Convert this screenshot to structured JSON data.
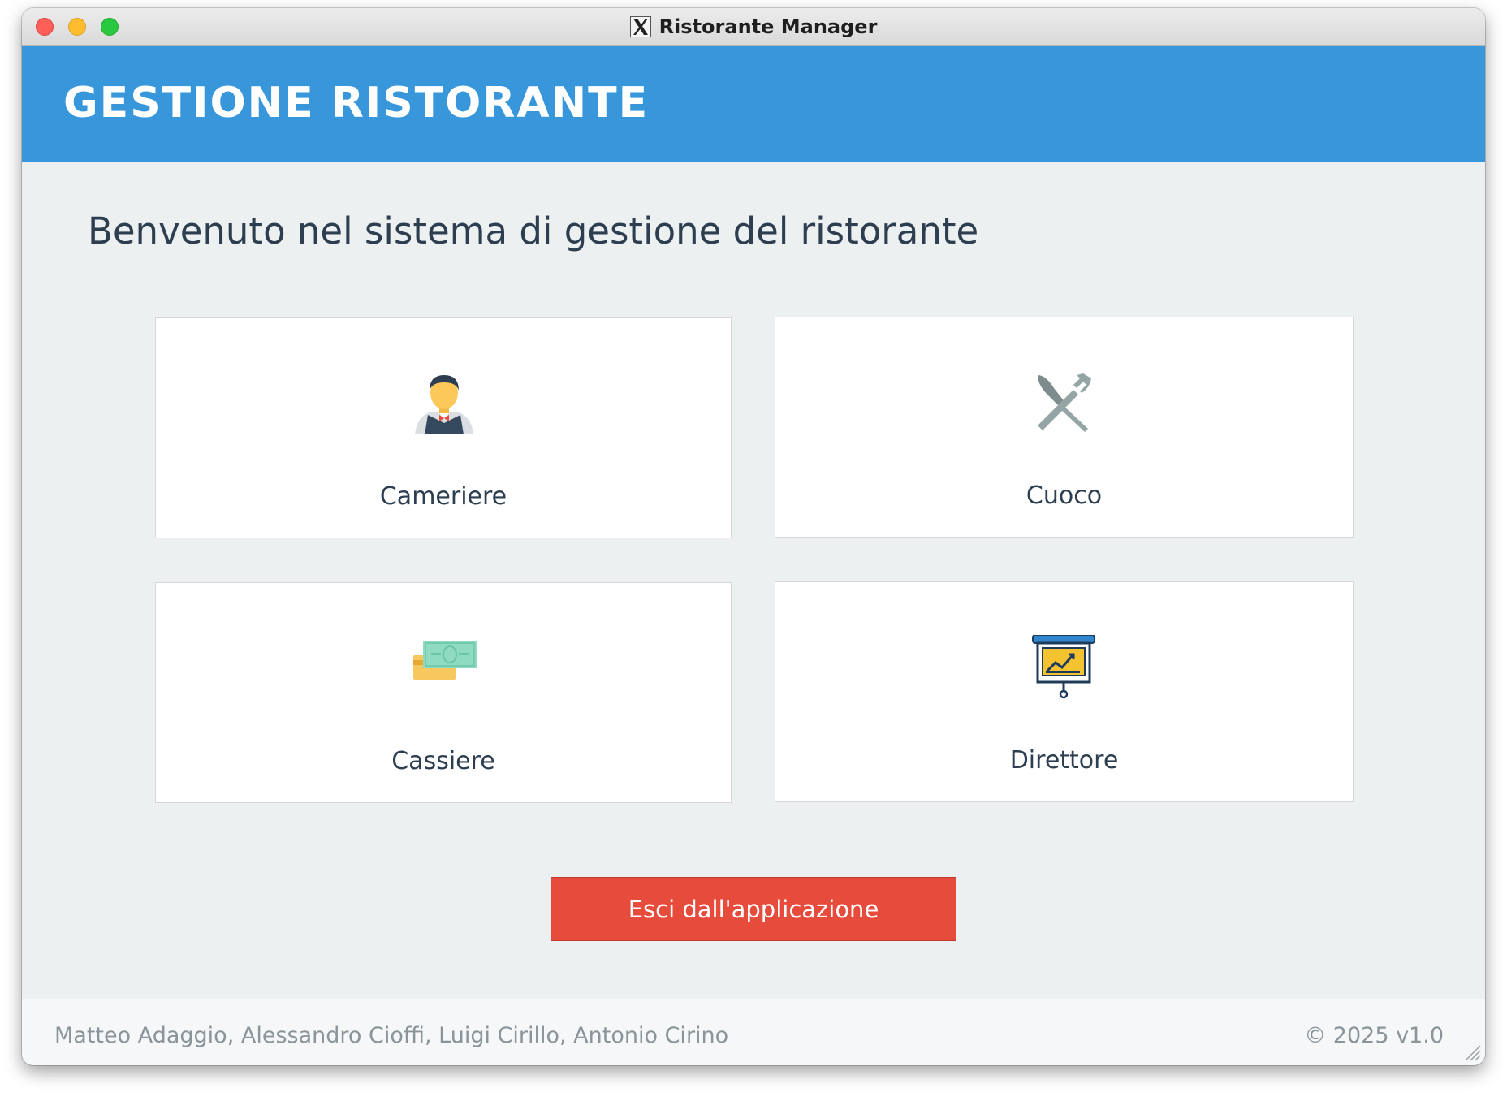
{
  "window": {
    "title": "Ristorante Manager"
  },
  "header": {
    "title": "GESTIONE RISTORANTE",
    "background": "#3797da"
  },
  "main": {
    "welcome": "Benvenuto nel sistema di gestione del ristorante",
    "roles": [
      {
        "label": "Cameriere",
        "icon": "waiter-icon"
      },
      {
        "label": "Cuoco",
        "icon": "knife-fork-icon"
      },
      {
        "label": "Cassiere",
        "icon": "cash-card-icon"
      },
      {
        "label": "Direttore",
        "icon": "presentation-chart-icon"
      }
    ],
    "exit_label": "Esci dall'applicazione",
    "exit_color": "#e74b3c"
  },
  "footer": {
    "authors": "Matteo Adaggio, Alessandro Cioffi, Luigi Cirillo, Antonio Cirino",
    "version": "© 2025 v1.0"
  }
}
